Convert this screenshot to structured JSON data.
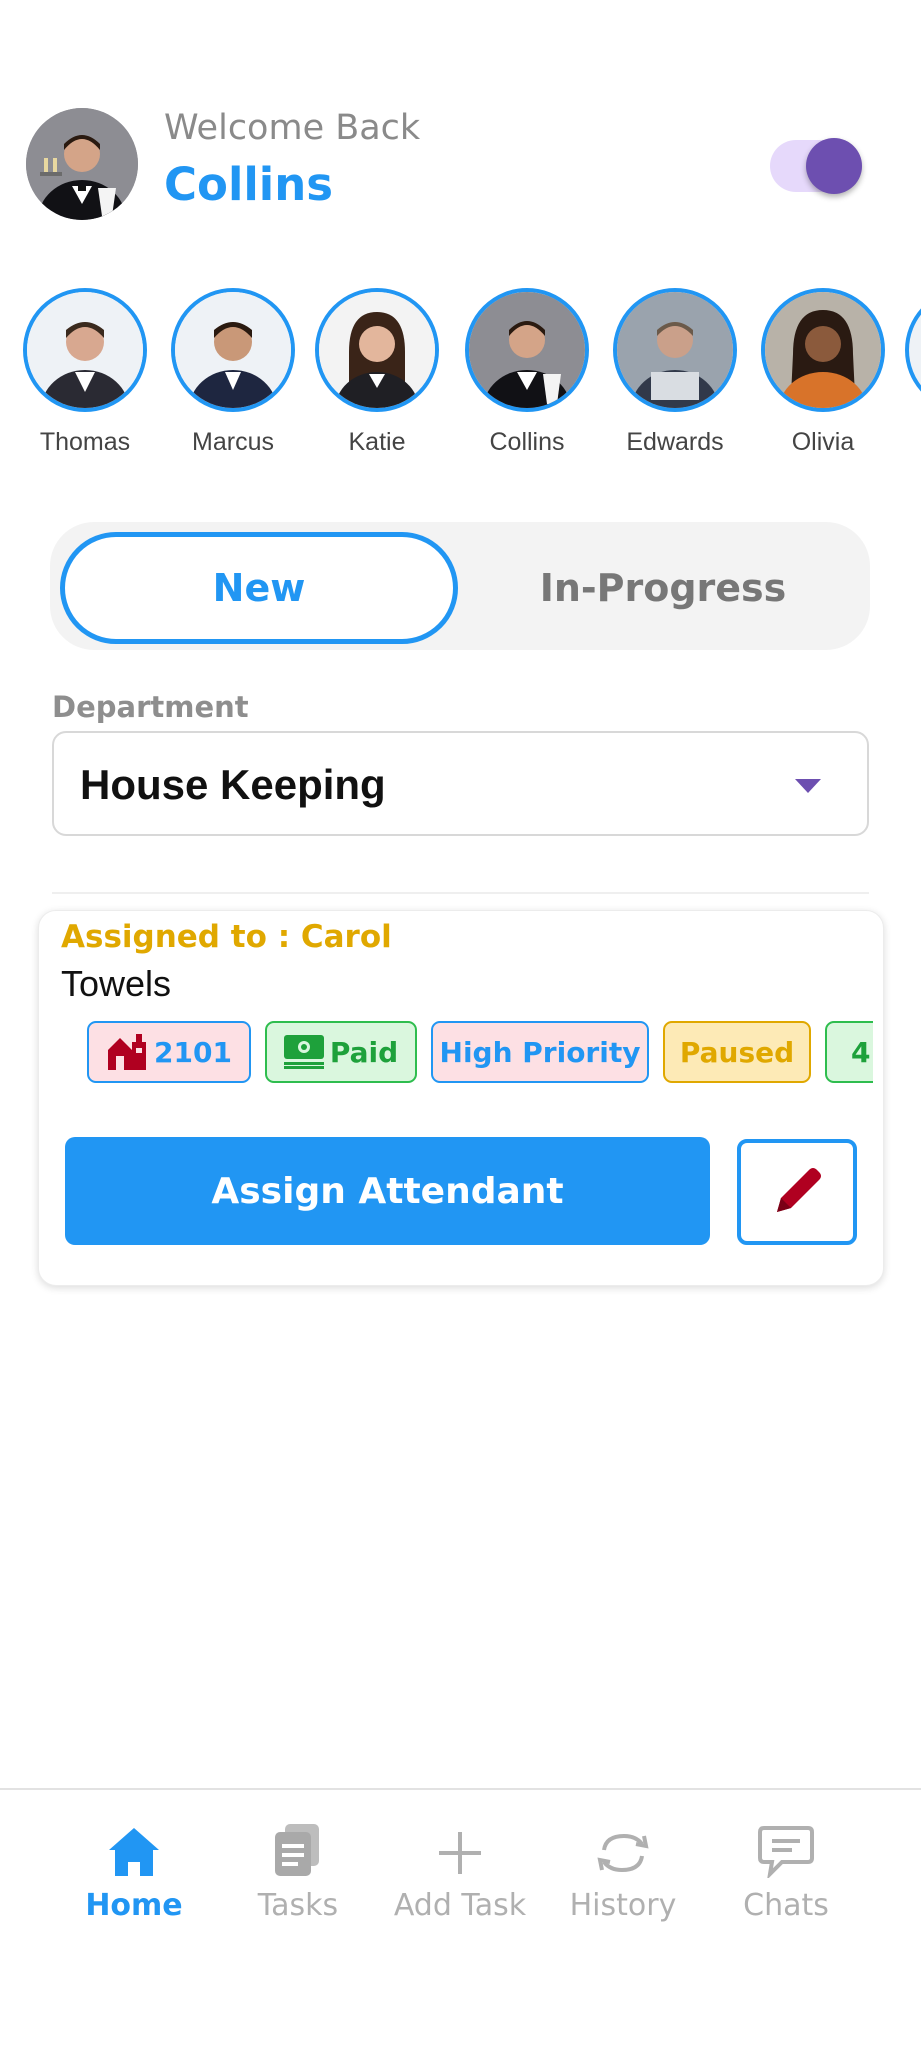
{
  "header": {
    "welcome_text": "Welcome Back",
    "username": "Collins",
    "theme_toggle_on": true
  },
  "staff": [
    {
      "name": "Thomas",
      "shirt": "#2a2a33",
      "skin": "#d8a890",
      "bg": "#eef2f6"
    },
    {
      "name": "Marcus",
      "shirt": "#1e2640",
      "skin": "#c99878",
      "bg": "#eef2f6"
    },
    {
      "name": "Katie",
      "shirt": "#1f1f24",
      "skin": "#e3b69c",
      "bg": "#f3f3f3"
    },
    {
      "name": "Collins",
      "shirt": "#111115",
      "skin": "#d4a488",
      "bg": "#8d8d93"
    },
    {
      "name": "Edwards",
      "shirt": "#31394a",
      "skin": "#caa08a",
      "bg": "#9aa3ad"
    },
    {
      "name": "Olivia",
      "shirt": "#d8732a",
      "skin": "#8b5a3c",
      "bg": "#b8b2a8"
    }
  ],
  "tabs": {
    "new": "New",
    "in_progress": "In-Progress",
    "active": "new"
  },
  "department": {
    "label": "Department",
    "selected": "House Keeping"
  },
  "task_card": {
    "assigned_to": "Assigned to : Carol",
    "title": "Towels",
    "tags": {
      "room": "2101",
      "payment": "Paid",
      "priority": "High Priority",
      "status": "Paused",
      "more": "4"
    },
    "assign_button": "Assign Attendant"
  },
  "bottom_nav": {
    "home": "Home",
    "tasks": "Tasks",
    "add_task": "Add Task",
    "history": "History",
    "chats": "Chats",
    "active": "home"
  },
  "colors": {
    "primary": "#2196F3",
    "accent_purple": "#6d4fb0",
    "assigned_yellow": "#e0a800",
    "paid_green": "#1ea13b",
    "room_icon_red": "#b00020"
  }
}
